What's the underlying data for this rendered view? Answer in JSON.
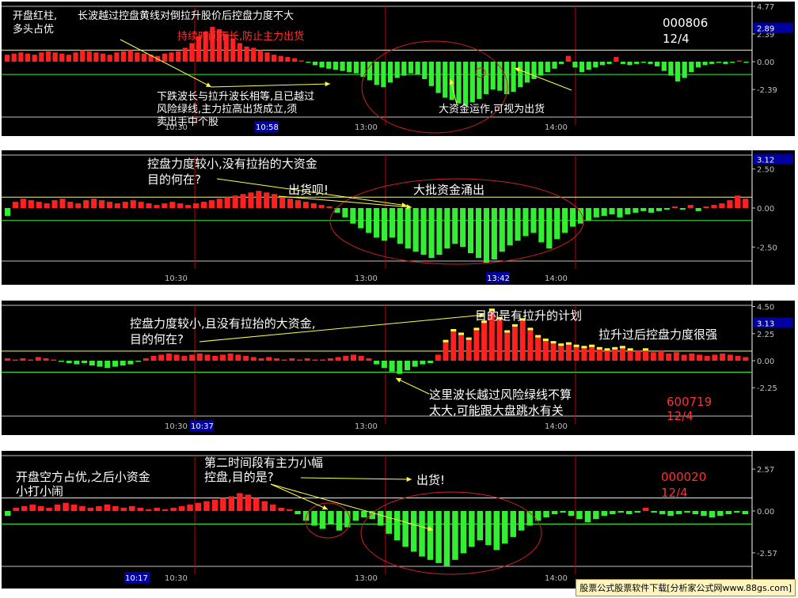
{
  "colors": {
    "up": "#ff2020",
    "down": "#33ee33",
    "yellow": "#ffff44",
    "grid": "#c00000",
    "tick": "#c0c0c0",
    "axis": "#ffffff",
    "white": "#ffffff",
    "ellipse": "#cc2222",
    "annoRed": "#ff3030",
    "box": "#0000a0"
  },
  "watermark": "股票公式股票软件下载[分析家公式网www.88gs.com]",
  "chart_data": [
    {
      "type": "bar",
      "series": [
        {
          "values": [
            0.6,
            0.7,
            0.8,
            0.7,
            0.6,
            0.8,
            0.9,
            0.8,
            0.7,
            0.6,
            0.8,
            1.0,
            0.9,
            0.8,
            0.7,
            0.6,
            0.8,
            0.9,
            1.0,
            0.8,
            0.7,
            0.6,
            0.5,
            0.7,
            0.8,
            0.9,
            1.2,
            1.6,
            2.2,
            2.6,
            3.0,
            2.8,
            2.4,
            2.0,
            1.6,
            1.3,
            1.2,
            1.0,
            0.8,
            0.6,
            0.5,
            0.4,
            0.3,
            0.1,
            -0.1,
            -0.3,
            -0.5,
            -0.6,
            -0.7,
            -0.8,
            -0.9,
            -1.0,
            -1.3,
            -1.6,
            -2.0,
            -2.2,
            -1.8,
            -1.4,
            -1.2,
            -1.0,
            -1.1,
            -1.5,
            -2.1,
            -2.7,
            -3.1,
            -3.3,
            -3.6,
            -3.8,
            -3.5,
            -3.2,
            -2.8,
            -2.4,
            -2.5,
            -2.8,
            -2.6,
            -2.2,
            -1.8,
            -1.5,
            -1.2,
            -0.9,
            -0.6,
            -0.2,
            0.5,
            -0.5,
            -0.9,
            -0.7,
            -0.5,
            -0.3,
            -0.2,
            0.4,
            -0.2,
            -0.3,
            -0.2,
            -0.1,
            -0.2,
            -0.4,
            -0.8,
            -1.2,
            -1.7,
            -1.4,
            -0.9,
            -0.5,
            -0.3,
            -0.2,
            -0.1,
            -0.2,
            -0.1,
            0.1,
            -0.1
          ]
        }
      ],
      "ylim": [
        -4.77,
        4.77
      ],
      "y_ticks": [
        "4.77",
        "2.39",
        "0.00",
        "-2.39"
      ],
      "y_highlight": "2.89",
      "yellow_line": 1.0,
      "green_line": -1.1,
      "x_ticks": [
        "10:30",
        "13:00",
        "14:00"
      ],
      "x_highlight": "10:58",
      "corner_text": [
        "000806",
        "12/4"
      ],
      "annotations": [
        "开盘红柱,",
        "多头占优",
        "长波越过控盘黄线对倒拉升股价后控盘力度不大",
        "持续时间不长,防止主力出货",
        "下跌波长与拉升波长相等,且已越过",
        "风险绿线,主力拉高出货成立,须",
        "卖出手中个股",
        "大资金运作,可视为出货"
      ]
    },
    {
      "type": "bar",
      "series": [
        {
          "values": [
            -0.5,
            0.4,
            0.6,
            0.5,
            0.4,
            0.3,
            0.5,
            0.6,
            0.4,
            0.3,
            0.5,
            0.6,
            0.5,
            0.4,
            0.3,
            0.4,
            0.5,
            0.4,
            0.3,
            0.2,
            0.3,
            0.4,
            0.3,
            0.2,
            0.3,
            0.4,
            0.5,
            0.6,
            0.7,
            0.8,
            0.9,
            1.0,
            1.1,
            1.0,
            0.9,
            0.7,
            0.6,
            0.5,
            0.4,
            0.3,
            0.2,
            0.1,
            -0.3,
            -0.6,
            -1.0,
            -1.3,
            -1.6,
            -1.9,
            -2.1,
            -1.9,
            -2.3,
            -2.6,
            -2.8,
            -3.0,
            -3.2,
            -3.0,
            -2.6,
            -2.3,
            -2.5,
            -2.9,
            -3.2,
            -3.5,
            -3.3,
            -2.8,
            -2.4,
            -2.1,
            -1.8,
            -1.6,
            -2.2,
            -2.6,
            -2.0,
            -1.6,
            -1.2,
            -1.0,
            -0.8,
            -0.6,
            -0.5,
            -0.4,
            -0.6,
            -0.4,
            -0.3,
            -0.2,
            -0.3,
            -0.2,
            -0.1,
            0.1,
            -0.1,
            0.2,
            -0.2,
            0.1,
            0.2,
            0.3,
            0.5,
            0.8,
            0.6
          ]
        }
      ],
      "ylim": [
        -3.4,
        3.4
      ],
      "y_ticks": [
        "2.50",
        "0.00",
        "-2.50"
      ],
      "y_highlight": "3.12",
      "yellow_line": 0.7,
      "green_line": -0.8,
      "x_ticks": [
        "10:30",
        "13:00",
        "14:00"
      ],
      "x_highlight": "13:42",
      "annotations": [
        "控盘力度较小,没有拉抬的大资金",
        "目的何在?",
        "出货呗!",
        "大批资金涌出"
      ]
    },
    {
      "type": "bar",
      "series": [
        {
          "values": [
            0.2,
            0.1,
            0.2,
            0.1,
            0.3,
            0.2,
            0.1,
            -0.1,
            -0.2,
            -0.3,
            -0.2,
            -0.4,
            -0.5,
            -0.6,
            -0.5,
            -0.4,
            -0.3,
            -0.1,
            0.2,
            0.4,
            0.5,
            0.6,
            0.5,
            0.4,
            0.5,
            0.6,
            0.5,
            0.4,
            0.5,
            0.6,
            0.5,
            0.4,
            0.3,
            0.2,
            0.3,
            0.2,
            0.1,
            0.2,
            0.1,
            0.2,
            0.1,
            0.1,
            0.2,
            0.3,
            0.4,
            0.5,
            0.4,
            0.2,
            -0.3,
            -0.6,
            -0.9,
            -1.1,
            -0.8,
            -0.5,
            -0.3,
            -0.2,
            0.5,
            1.6,
            2.5,
            2.2,
            1.8,
            2.6,
            3.2,
            4.2,
            3.5,
            2.4,
            2.9,
            3.4,
            2.6,
            2.0,
            1.7,
            1.5,
            1.3,
            1.4,
            1.2,
            1.1,
            1.2,
            1.0,
            0.9,
            1.0,
            1.1,
            0.9,
            0.8,
            0.9,
            0.7,
            0.8,
            0.6,
            0.7,
            0.5,
            0.6,
            0.5,
            0.4,
            0.5,
            0.6,
            0.5,
            0.4,
            0.3
          ]
        }
      ],
      "ylim": [
        -4.6,
        4.6
      ],
      "y_ticks": [
        "4.50",
        "2.25",
        "0.00",
        "-2.25"
      ],
      "y_highlight": "3.13",
      "yellow_line": 0.8,
      "green_line": -0.95,
      "x_ticks": [
        "10:30",
        "13:00",
        "14:00"
      ],
      "x_highlight": "10:37",
      "corner_text": [
        "600719",
        "12/4"
      ],
      "annotations": [
        "控盘力度较小,且没有拉抬的大资金,",
        "目的何在?",
        "目的是有拉升的计划",
        "拉升过后控盘力度很强",
        "这里波长越过风险绿线不算",
        "太大,可能跟大盘跳水有关"
      ]
    },
    {
      "type": "bar",
      "series": [
        {
          "values": [
            -0.3,
            0.2,
            0.3,
            0.4,
            0.3,
            0.2,
            0.4,
            0.5,
            0.4,
            0.3,
            0.2,
            0.3,
            0.4,
            0.3,
            0.2,
            0.3,
            0.2,
            0.1,
            0.2,
            0.1,
            0.2,
            0.3,
            0.4,
            0.5,
            0.6,
            0.7,
            0.8,
            0.9,
            1.1,
            1.0,
            0.8,
            0.6,
            0.4,
            0.2,
            0.1,
            -0.2,
            -0.6,
            -0.9,
            -1.1,
            -0.8,
            -1.2,
            -1.0,
            -0.6,
            -0.4,
            -0.5,
            -0.9,
            -1.4,
            -1.8,
            -2.2,
            -2.5,
            -2.8,
            -3.0,
            -3.2,
            -3.4,
            -3.0,
            -2.6,
            -2.2,
            -1.8,
            -2.1,
            -2.4,
            -2.0,
            -1.6,
            -1.2,
            -0.9,
            -0.6,
            -0.4,
            -0.2,
            -0.1,
            -0.3,
            -0.5,
            -0.7,
            -0.5,
            -0.3,
            -0.2,
            -0.1,
            -0.2,
            -0.1,
            0.2,
            -0.1,
            -0.2,
            -0.3,
            -0.2,
            -0.1,
            -0.2,
            -0.3,
            -0.4,
            -0.3,
            -0.2,
            -0.1,
            -0.2
          ]
        }
      ],
      "ylim": [
        -3.4,
        3.4
      ],
      "y_ticks": [
        "2.57",
        "0.00",
        "-2.57"
      ],
      "yellow_line": 0.8,
      "green_line": -0.8,
      "x_ticks": [
        "10:30",
        "13:00",
        "14:00"
      ],
      "x_highlight": "10:17",
      "corner_text": [
        "000020",
        "12/4"
      ],
      "annotations": [
        "开盘空方占优,之后小资金",
        "小打小闹",
        "第二时间段有主力小幅",
        "控盘,目的是?",
        "出货!"
      ]
    }
  ]
}
